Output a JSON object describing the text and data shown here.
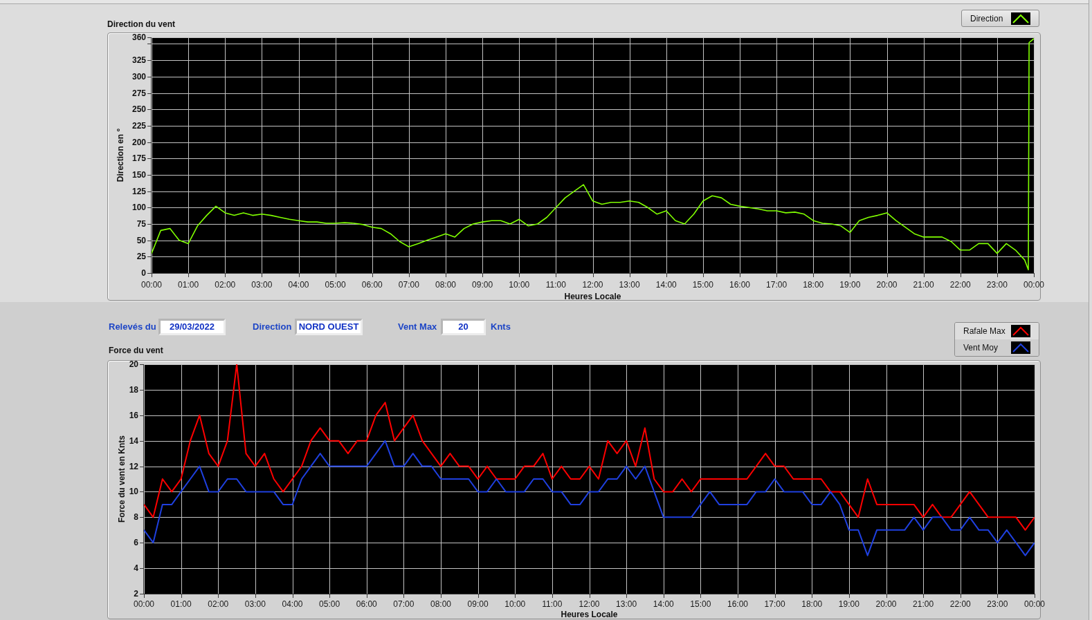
{
  "direction_chart": {
    "title": "Direction du vent",
    "chart_data": {
      "type": "line",
      "xlabel": "Heures Locale",
      "ylabel": "Direction en °",
      "grid": true,
      "x": [
        0,
        0.25,
        0.5,
        0.75,
        1,
        1.25,
        1.5,
        1.75,
        2,
        2.25,
        2.5,
        2.75,
        3,
        3.25,
        3.5,
        3.75,
        4,
        4.25,
        4.5,
        4.75,
        5,
        5.25,
        5.5,
        5.75,
        6,
        6.25,
        6.5,
        6.75,
        7,
        7.25,
        7.5,
        7.75,
        8,
        8.25,
        8.5,
        8.75,
        9,
        9.25,
        9.5,
        9.75,
        10,
        10.25,
        10.5,
        10.75,
        11,
        11.25,
        11.5,
        11.75,
        12,
        12.25,
        12.5,
        12.75,
        13,
        13.25,
        13.5,
        13.75,
        14,
        14.25,
        14.5,
        14.75,
        15,
        15.25,
        15.5,
        15.75,
        16,
        16.25,
        16.5,
        16.75,
        17,
        17.25,
        17.5,
        17.75,
        18,
        18.25,
        18.5,
        18.75,
        19,
        19.25,
        19.5,
        19.75,
        20,
        20.25,
        20.5,
        20.75,
        21,
        21.25,
        21.5,
        21.75,
        22,
        22.25,
        22.5,
        22.75,
        23,
        23.25,
        23.5,
        23.75,
        23.85,
        23.87,
        24
      ],
      "series": [
        {
          "name": "Direction",
          "color": "#80ff00",
          "values": [
            30,
            65,
            68,
            50,
            45,
            72,
            88,
            102,
            92,
            88,
            92,
            88,
            90,
            88,
            85,
            82,
            80,
            78,
            78,
            76,
            76,
            77,
            76,
            74,
            70,
            68,
            60,
            48,
            40,
            45,
            50,
            55,
            60,
            55,
            68,
            75,
            78,
            80,
            80,
            75,
            82,
            72,
            75,
            85,
            100,
            115,
            125,
            135,
            110,
            105,
            108,
            108,
            110,
            108,
            100,
            90,
            95,
            80,
            75,
            90,
            110,
            118,
            115,
            105,
            102,
            100,
            98,
            95,
            95,
            92,
            93,
            90,
            80,
            76,
            75,
            72,
            62,
            80,
            85,
            88,
            92,
            80,
            70,
            60,
            55,
            55,
            55,
            48,
            35,
            35,
            45,
            45,
            30,
            45,
            35,
            20,
            5,
            352,
            358
          ]
        }
      ],
      "xlim": [
        0,
        24
      ],
      "ylim": [
        0,
        360
      ],
      "xticks": [
        {
          "value": 0,
          "label": "00:00"
        },
        {
          "value": 1,
          "label": "01:00"
        },
        {
          "value": 2,
          "label": "02:00"
        },
        {
          "value": 3,
          "label": "03:00"
        },
        {
          "value": 4,
          "label": "04:00"
        },
        {
          "value": 5,
          "label": "05:00"
        },
        {
          "value": 6,
          "label": "06:00"
        },
        {
          "value": 7,
          "label": "07:00"
        },
        {
          "value": 8,
          "label": "08:00"
        },
        {
          "value": 9,
          "label": "09:00"
        },
        {
          "value": 10,
          "label": "10:00"
        },
        {
          "value": 11,
          "label": "11:00"
        },
        {
          "value": 12,
          "label": "12:00"
        },
        {
          "value": 13,
          "label": "13:00"
        },
        {
          "value": 14,
          "label": "14:00"
        },
        {
          "value": 15,
          "label": "15:00"
        },
        {
          "value": 16,
          "label": "16:00"
        },
        {
          "value": 17,
          "label": "17:00"
        },
        {
          "value": 18,
          "label": "18:00"
        },
        {
          "value": 19,
          "label": "19:00"
        },
        {
          "value": 20,
          "label": "20:00"
        },
        {
          "value": 21,
          "label": "21:00"
        },
        {
          "value": 22,
          "label": "22:00"
        },
        {
          "value": 23,
          "label": "23:00"
        },
        {
          "value": 24,
          "label": "00:00"
        }
      ],
      "yticks": [
        0,
        25,
        50,
        75,
        100,
        125,
        150,
        175,
        200,
        225,
        250,
        275,
        300,
        325,
        360
      ]
    }
  },
  "readings": [
    {
      "label": "Relevés du",
      "value": "29/03/2022"
    },
    {
      "label": "Direction",
      "value": "NORD OUEST"
    },
    {
      "label": "Vent Max",
      "value": "20",
      "unit": "Knts"
    }
  ],
  "force_chart": {
    "title": "Force du vent",
    "chart_data": {
      "type": "line",
      "xlabel": "Heures Locale",
      "ylabel": "Force du vent en Knts",
      "grid": true,
      "x": [
        0,
        0.25,
        0.5,
        0.75,
        1,
        1.25,
        1.5,
        1.75,
        2,
        2.25,
        2.5,
        2.75,
        3,
        3.25,
        3.5,
        3.75,
        4,
        4.25,
        4.5,
        4.75,
        5,
        5.25,
        5.5,
        5.75,
        6,
        6.25,
        6.5,
        6.75,
        7,
        7.25,
        7.5,
        7.75,
        8,
        8.25,
        8.5,
        8.75,
        9,
        9.25,
        9.5,
        9.75,
        10,
        10.25,
        10.5,
        10.75,
        11,
        11.25,
        11.5,
        11.75,
        12,
        12.25,
        12.5,
        12.75,
        13,
        13.25,
        13.5,
        13.75,
        14,
        14.25,
        14.5,
        14.75,
        15,
        15.25,
        15.5,
        15.75,
        16,
        16.25,
        16.5,
        16.75,
        17,
        17.25,
        17.5,
        17.75,
        18,
        18.25,
        18.5,
        18.75,
        19,
        19.25,
        19.5,
        19.75,
        20,
        20.25,
        20.5,
        20.75,
        21,
        21.25,
        21.5,
        21.75,
        22,
        22.25,
        22.5,
        22.75,
        23,
        23.25,
        23.5,
        23.75,
        24
      ],
      "series": [
        {
          "name": "Rafale Max",
          "color": "#ff0000",
          "values": [
            9,
            8,
            11,
            10,
            11,
            14,
            16,
            13,
            12,
            14,
            20,
            13,
            12,
            13,
            11,
            10,
            11,
            12,
            14,
            15,
            14,
            14,
            13,
            14,
            14,
            16,
            17,
            14,
            15,
            16,
            14,
            13,
            12,
            13,
            12,
            12,
            11,
            12,
            11,
            11,
            11,
            12,
            12,
            13,
            11,
            12,
            11,
            11,
            12,
            11,
            14,
            13,
            14,
            12,
            15,
            11,
            10,
            10,
            11,
            10,
            11,
            11,
            11,
            11,
            11,
            11,
            12,
            13,
            12,
            12,
            11,
            11,
            11,
            11,
            10,
            10,
            9,
            8,
            11,
            9,
            9,
            9,
            9,
            9,
            8,
            9,
            8,
            8,
            9,
            10,
            9,
            8,
            8,
            8,
            8,
            7,
            8
          ]
        },
        {
          "name": "Vent Moy",
          "color": "#1f40e0",
          "values": [
            7,
            6,
            9,
            9,
            10,
            11,
            12,
            10,
            10,
            11,
            11,
            10,
            10,
            10,
            10,
            9,
            9,
            11,
            12,
            13,
            12,
            12,
            12,
            12,
            12,
            13,
            14,
            12,
            12,
            13,
            12,
            12,
            11,
            11,
            11,
            11,
            10,
            10,
            11,
            10,
            10,
            10,
            11,
            11,
            10,
            10,
            9,
            9,
            10,
            10,
            11,
            11,
            12,
            11,
            12,
            10,
            8,
            8,
            8,
            8,
            9,
            10,
            9,
            9,
            9,
            9,
            10,
            10,
            11,
            10,
            10,
            10,
            9,
            9,
            10,
            9,
            7,
            7,
            5,
            7,
            7,
            7,
            7,
            8,
            7,
            8,
            8,
            7,
            7,
            8,
            7,
            7,
            6,
            7,
            6,
            5,
            6
          ]
        }
      ],
      "xlim": [
        0,
        24
      ],
      "ylim": [
        2,
        20
      ],
      "xticks": [
        {
          "value": 0,
          "label": "00:00"
        },
        {
          "value": 1,
          "label": "01:00"
        },
        {
          "value": 2,
          "label": "02:00"
        },
        {
          "value": 3,
          "label": "03:00"
        },
        {
          "value": 4,
          "label": "04:00"
        },
        {
          "value": 5,
          "label": "05:00"
        },
        {
          "value": 6,
          "label": "06:00"
        },
        {
          "value": 7,
          "label": "07:00"
        },
        {
          "value": 8,
          "label": "08:00"
        },
        {
          "value": 9,
          "label": "09:00"
        },
        {
          "value": 10,
          "label": "10:00"
        },
        {
          "value": 11,
          "label": "11:00"
        },
        {
          "value": 12,
          "label": "12:00"
        },
        {
          "value": 13,
          "label": "13:00"
        },
        {
          "value": 14,
          "label": "14:00"
        },
        {
          "value": 15,
          "label": "15:00"
        },
        {
          "value": 16,
          "label": "16:00"
        },
        {
          "value": 17,
          "label": "17:00"
        },
        {
          "value": 18,
          "label": "18:00"
        },
        {
          "value": 19,
          "label": "19:00"
        },
        {
          "value": 20,
          "label": "20:00"
        },
        {
          "value": 21,
          "label": "21:00"
        },
        {
          "value": 22,
          "label": "22:00"
        },
        {
          "value": 23,
          "label": "23:00"
        },
        {
          "value": 24,
          "label": "00:00"
        }
      ],
      "yticks": [
        2,
        4,
        6,
        8,
        10,
        12,
        14,
        16,
        18,
        20
      ]
    }
  }
}
